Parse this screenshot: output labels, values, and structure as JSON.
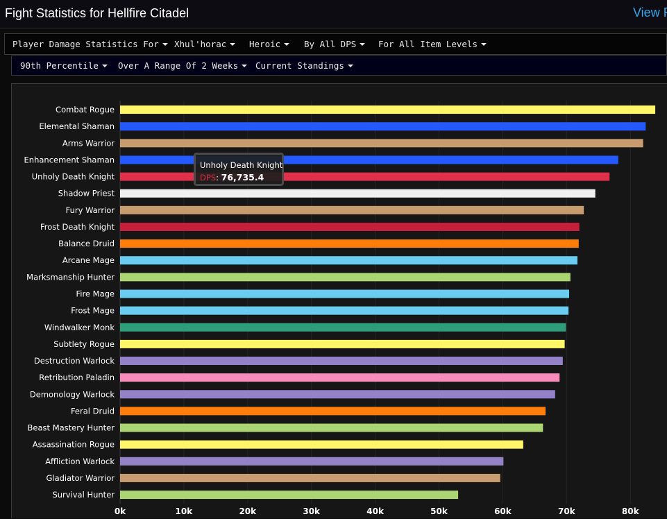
{
  "header": {
    "title": "Fight Statistics for Hellfire Citadel",
    "view_link": "View F"
  },
  "filters": [
    {
      "label": "Player Damage Statistics For"
    },
    {
      "label": "Xhul'horac"
    },
    {
      "label": "Heroic"
    },
    {
      "label": "By All DPS"
    },
    {
      "label": "For All Item Levels"
    }
  ],
  "subfilters": [
    {
      "label": "90th Percentile"
    },
    {
      "label": "Over A Range Of 2 Weeks"
    },
    {
      "label": "Current Standings"
    }
  ],
  "tooltip": {
    "name": "Unholy Death Knight",
    "label": "DPS",
    "value": "76,735.4"
  },
  "chart_data": {
    "type": "bar",
    "orientation": "horizontal",
    "categories": [
      "Combat Rogue",
      "Elemental Shaman",
      "Arms Warrior",
      "Enhancement Shaman",
      "Unholy Death Knight",
      "Shadow Priest",
      "Fury Warrior",
      "Frost Death Knight",
      "Balance Druid",
      "Arcane Mage",
      "Marksmanship Hunter",
      "Fire Mage",
      "Frost Mage",
      "Windwalker Monk",
      "Subtlety Rogue",
      "Destruction Warlock",
      "Retribution Paladin",
      "Demonology Warlock",
      "Feral Druid",
      "Beast Mastery Hunter",
      "Assassination Rogue",
      "Affliction Warlock",
      "Gladiator Warrior",
      "Survival Hunter"
    ],
    "values": [
      83900,
      82400,
      82000,
      78100,
      76735.4,
      74500,
      72700,
      72000,
      71900,
      71700,
      70600,
      70400,
      70300,
      69900,
      69700,
      69400,
      68900,
      68200,
      66700,
      66300,
      63200,
      60100,
      59600,
      53000
    ],
    "colors": [
      "#fff569",
      "#2459ff",
      "#c79c6e",
      "#2459ff",
      "#e0304a",
      "#f0f0f0",
      "#c79c6e",
      "#c41f3b",
      "#ff7d0a",
      "#69ccf0",
      "#abd473",
      "#69ccf0",
      "#69ccf0",
      "#2e9e7a",
      "#fff569",
      "#9482c9",
      "#f58cba",
      "#9482c9",
      "#ff7d0a",
      "#abd473",
      "#fff569",
      "#9482c9",
      "#c79c6e",
      "#abd473"
    ],
    "x_ticks": [
      "0k",
      "10k",
      "20k",
      "30k",
      "40k",
      "50k",
      "60k",
      "70k",
      "80k"
    ],
    "xlim": [
      0,
      84000
    ],
    "grid": true
  }
}
